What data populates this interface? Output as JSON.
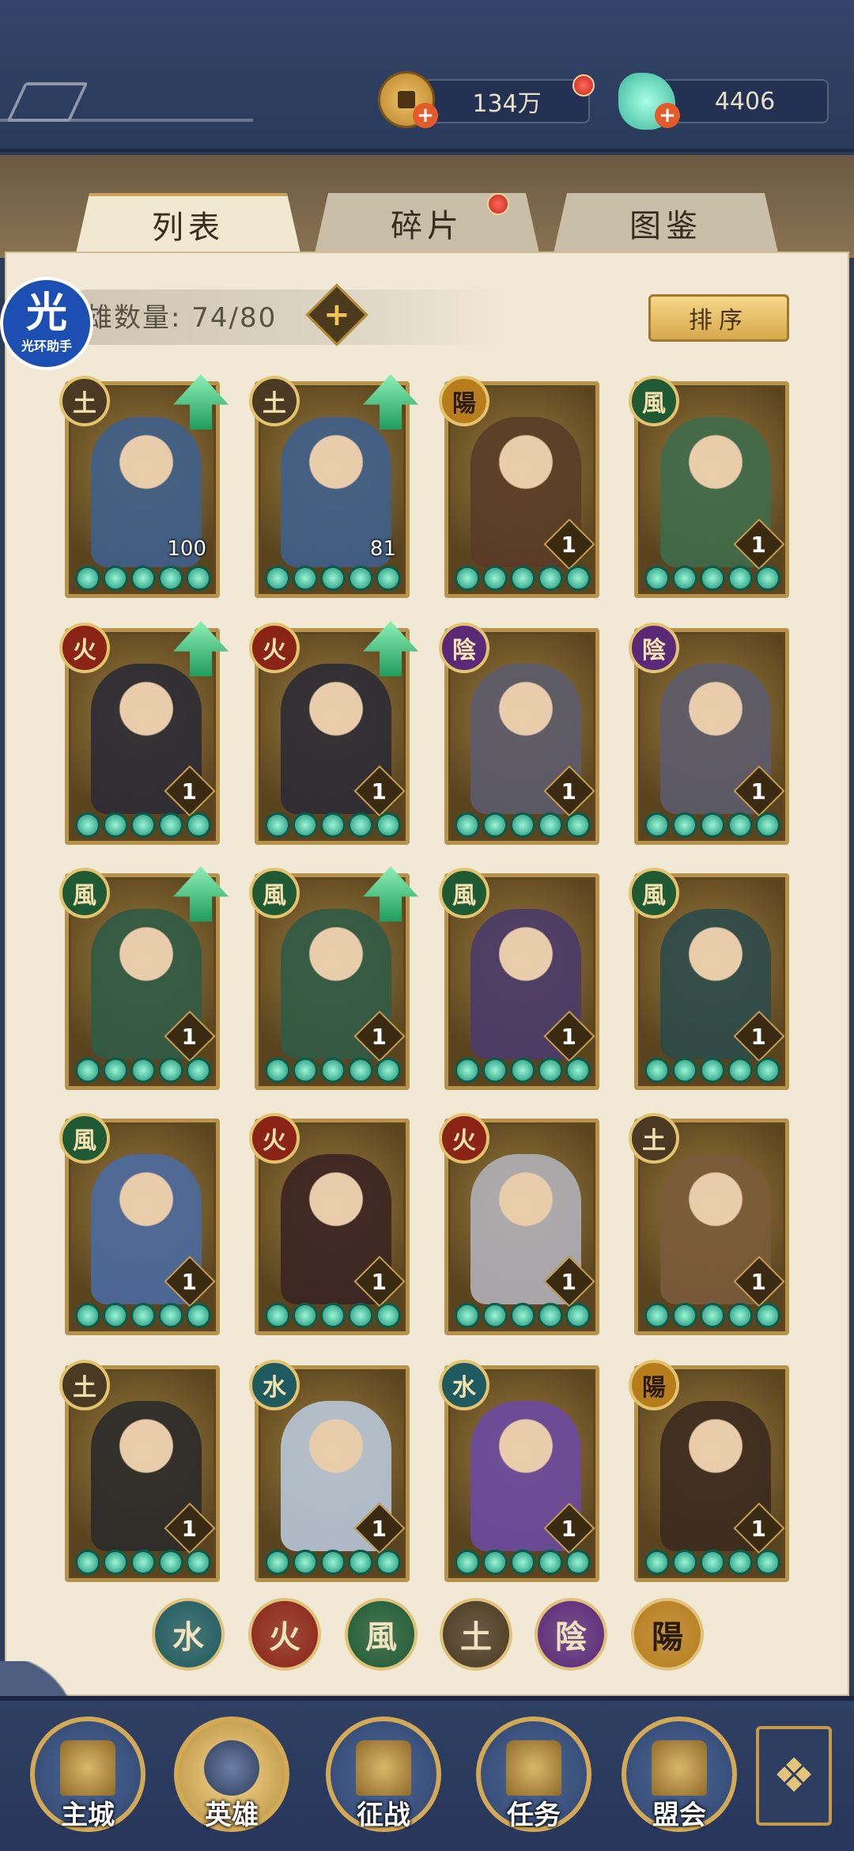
{
  "currency": {
    "coins_value": "134万",
    "jade_value": "4406"
  },
  "tabs": [
    {
      "label": "列表"
    },
    {
      "label": "碎片"
    },
    {
      "label": "图鉴"
    }
  ],
  "hero_count": {
    "text": "雄数量: 74/80"
  },
  "sort_label": "排序",
  "helper_badge": {
    "big": "光",
    "small": "光环助手"
  },
  "heroes": [
    {
      "element": "土",
      "level": "100",
      "upgrade": true
    },
    {
      "element": "土",
      "level": "81",
      "upgrade": true
    },
    {
      "element": "陽",
      "level": "1",
      "upgrade": false
    },
    {
      "element": "風",
      "level": "1",
      "upgrade": false
    },
    {
      "element": "火",
      "level": "1",
      "upgrade": true
    },
    {
      "element": "火",
      "level": "1",
      "upgrade": true
    },
    {
      "element": "陰",
      "level": "1",
      "upgrade": false
    },
    {
      "element": "陰",
      "level": "1",
      "upgrade": false
    },
    {
      "element": "風",
      "level": "1",
      "upgrade": true
    },
    {
      "element": "風",
      "level": "1",
      "upgrade": true
    },
    {
      "element": "風",
      "level": "1",
      "upgrade": false
    },
    {
      "element": "風",
      "level": "1",
      "upgrade": false
    },
    {
      "element": "風",
      "level": "1",
      "upgrade": false
    },
    {
      "element": "火",
      "level": "1",
      "upgrade": false
    },
    {
      "element": "火",
      "level": "1",
      "upgrade": false
    },
    {
      "element": "土",
      "level": "1",
      "upgrade": false
    },
    {
      "element": "土",
      "level": "1",
      "upgrade": false
    },
    {
      "element": "水",
      "level": "1",
      "upgrade": false
    },
    {
      "element": "水",
      "level": "1",
      "upgrade": false
    },
    {
      "element": "陽",
      "level": "1",
      "upgrade": false
    }
  ],
  "element_colors": {
    "水": "#1e5a5f",
    "火": "#8a2416",
    "風": "#1f5a35",
    "土": "#4a3a24",
    "陰": "#5a2a78",
    "陽": "#b77d1c"
  },
  "filters": [
    "水",
    "火",
    "風",
    "土",
    "陰",
    "陽"
  ],
  "nav": [
    {
      "label": "主城",
      "icon": "castle-icon"
    },
    {
      "label": "英雄",
      "icon": "hero-icon"
    },
    {
      "label": "征战",
      "icon": "battle-icon"
    },
    {
      "label": "任务",
      "icon": "task-icon"
    },
    {
      "label": "盟会",
      "icon": "guild-icon"
    }
  ]
}
